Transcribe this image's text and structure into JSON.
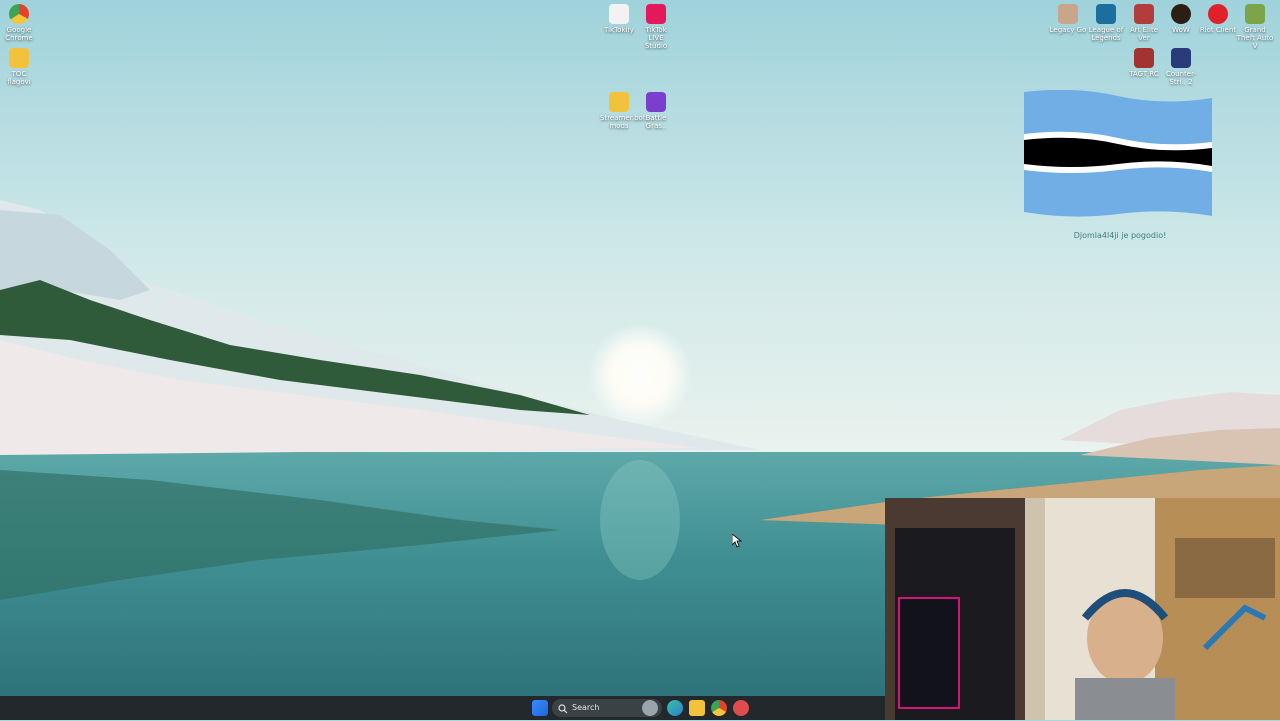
{
  "desktop": {
    "icons_left": [
      {
        "label": "Google Chrome",
        "color": "#e3432c"
      },
      {
        "label": "TOC flagovi",
        "color": "#f2c23c"
      }
    ],
    "icons_center": [
      {
        "label": "TikTokify",
        "color": "#f2f2f2"
      },
      {
        "label": "TikTok LIVE Studio",
        "color": "#e3195b"
      },
      {
        "label": "Streamer.bot mods",
        "color": "#f2c23c"
      },
      {
        "label": "Battle Gras..",
        "color": "#7b3fd0"
      }
    ],
    "icons_right": [
      {
        "label": "Legacy Go",
        "color": "#c9a58c"
      },
      {
        "label": "League of Legends",
        "color": "#1a6f9c"
      },
      {
        "label": "Art Elite Ver",
        "color": "#b33c3c"
      },
      {
        "label": "WoW",
        "color": "#2b1f14"
      },
      {
        "label": "Riot Client",
        "color": "#e0202a"
      },
      {
        "label": "Grand Theft Auto V",
        "color": "#7ea44a"
      },
      {
        "label": "TAGT RC",
        "color": "#a33"
      },
      {
        "label": "Counter-Stri.. 2",
        "color": "#2a3b7a"
      }
    ]
  },
  "flag_widget": {
    "caption": "Djomla4l4ji je pogodio!",
    "colors": {
      "blue": "#72aee6",
      "white": "#ffffff",
      "black": "#000000"
    }
  },
  "taskbar": {
    "search_label": "Search",
    "apps": [
      "start-icon",
      "widget-icon",
      "edge-icon",
      "file-explorer-icon",
      "chrome-icon",
      "snipping-icon"
    ]
  }
}
